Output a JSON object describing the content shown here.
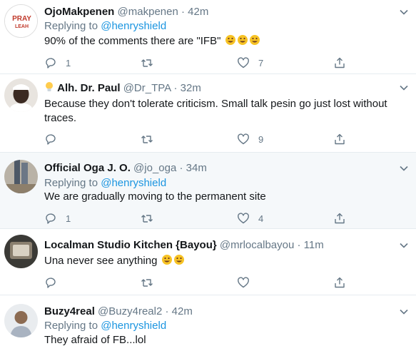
{
  "colors": {
    "name": "#14171a",
    "meta": "#657786",
    "link": "#1b95e0",
    "divider": "#e6ecf0",
    "highlight": "#f5f8fa"
  },
  "tweets": [
    {
      "name": "OjoMakpenen",
      "handle": "@makpenen",
      "time": "· 42m",
      "replying_prefix": "Replying to",
      "replying_handle": "@henryshield",
      "text": "90% of the comments there are \"IFB\"",
      "emoji_count": 3,
      "replies": "1",
      "retweets": "",
      "likes": "7",
      "avatar_text_lines": [
        "PRAY",
        "LEAH"
      ]
    },
    {
      "name_icon": "lightbulb-icon",
      "name": "Alh. Dr. Paul",
      "handle": "@Dr_TPA",
      "time": "· 32m",
      "text": "Because they don't tolerate criticism. Small talk pesin go just lost without traces.",
      "replies": "",
      "retweets": "",
      "likes": "9"
    },
    {
      "name": "Official Oga J. O.",
      "handle": "@jo_oga",
      "time": "· 34m",
      "replying_prefix": "Replying to",
      "replying_handle": "@henryshield",
      "text": "We are gradually moving to the permanent site",
      "replies": "1",
      "retweets": "",
      "likes": "4"
    },
    {
      "name": "Localman Studio Kitchen {Bayou}",
      "handle": "@mrlocalbayou",
      "time": "· 11m",
      "text": "Una never see anything",
      "emoji_count": 2,
      "replies": "",
      "retweets": "",
      "likes": ""
    },
    {
      "name": "Buzy4real",
      "handle": "@Buzy4real2",
      "time": "· 42m",
      "replying_prefix": "Replying to",
      "replying_handle": "@henryshield",
      "text": "They afraid of FB...lol",
      "replies": "",
      "retweets": "",
      "likes": ""
    }
  ]
}
